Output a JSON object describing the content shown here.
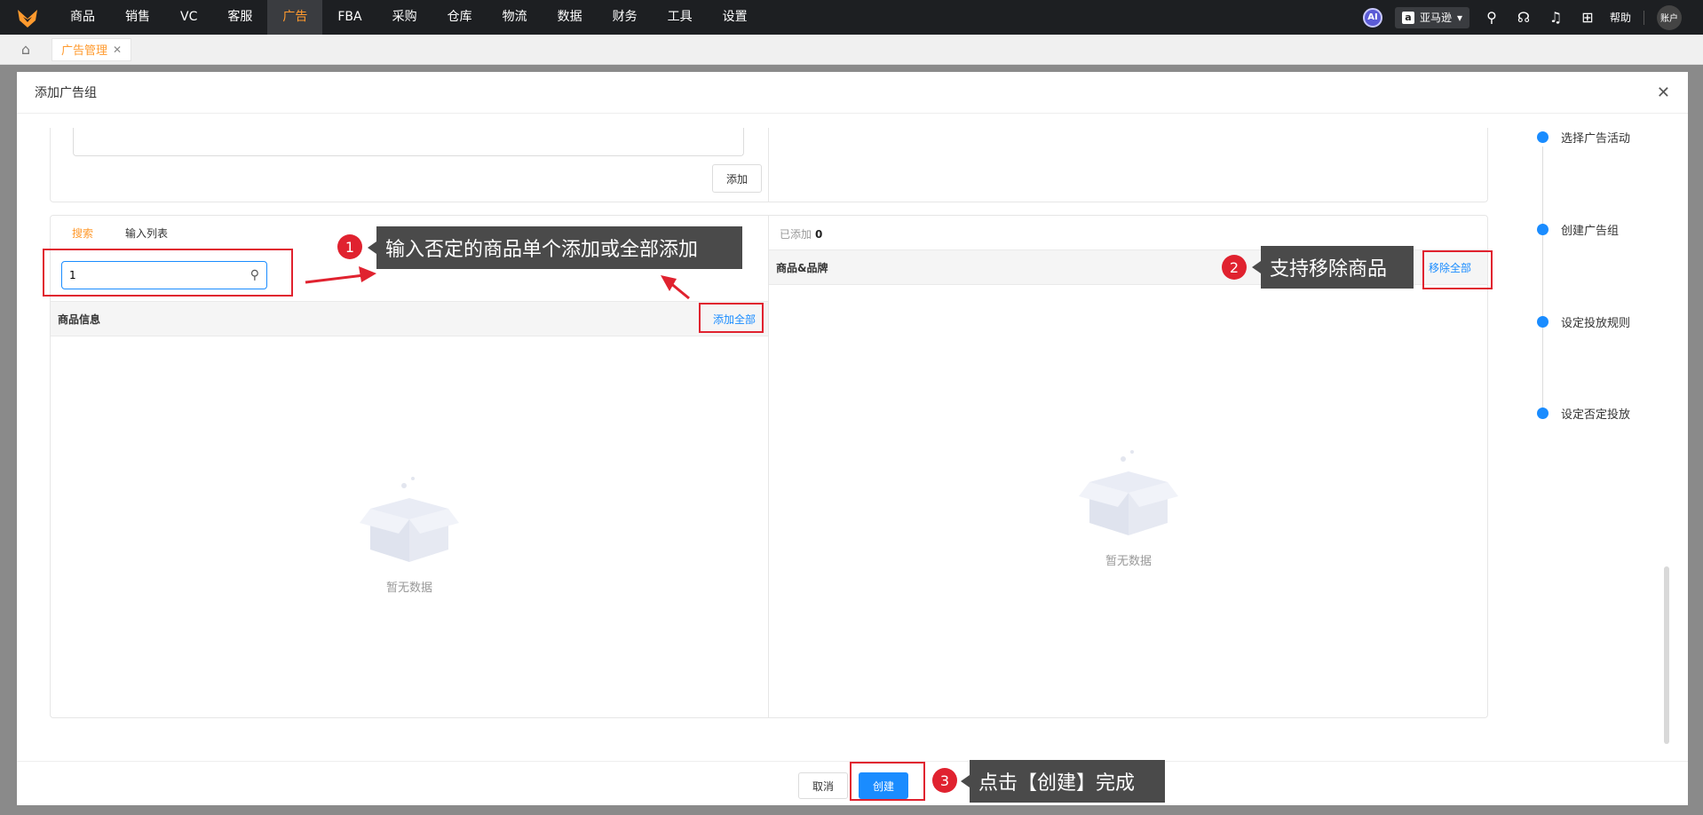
{
  "nav": {
    "items": [
      "商品",
      "销售",
      "VC",
      "客服",
      "广告",
      "FBA",
      "采购",
      "仓库",
      "物流",
      "数据",
      "财务",
      "工具",
      "设置"
    ],
    "active_index": 4,
    "ai_label": "AI",
    "store_label": "亚马逊",
    "store_logo": "a",
    "help_label": "帮助",
    "account_label": "账户"
  },
  "tabstrip": {
    "tab_label": "广告管理"
  },
  "modal": {
    "title": "添加广告组",
    "top_add_label": "添加",
    "tabs": [
      "搜索",
      "输入列表"
    ],
    "search_value": "1",
    "left_header": "商品信息",
    "add_all_label": "添加全部",
    "added_prefix": "已添加",
    "added_count": "0",
    "right_header": "商品&品牌",
    "remove_all_label": "移除全部",
    "empty_text": "暂无数据",
    "cancel_label": "取消",
    "create_label": "创建"
  },
  "steps": [
    "选择广告活动",
    "创建广告组",
    "设定投放规则",
    "设定否定投放"
  ],
  "annotations": {
    "a1": {
      "number": "1",
      "text": "输入否定的商品单个添加或全部添加"
    },
    "a2": {
      "number": "2",
      "text": "支持移除商品"
    },
    "a3": {
      "number": "3",
      "text": "点击【创建】完成"
    }
  },
  "colors": {
    "accent": "#ff9a2e",
    "primary": "#1a8cff",
    "annotation": "#e0222f",
    "nav_bg": "#1d1f22"
  }
}
